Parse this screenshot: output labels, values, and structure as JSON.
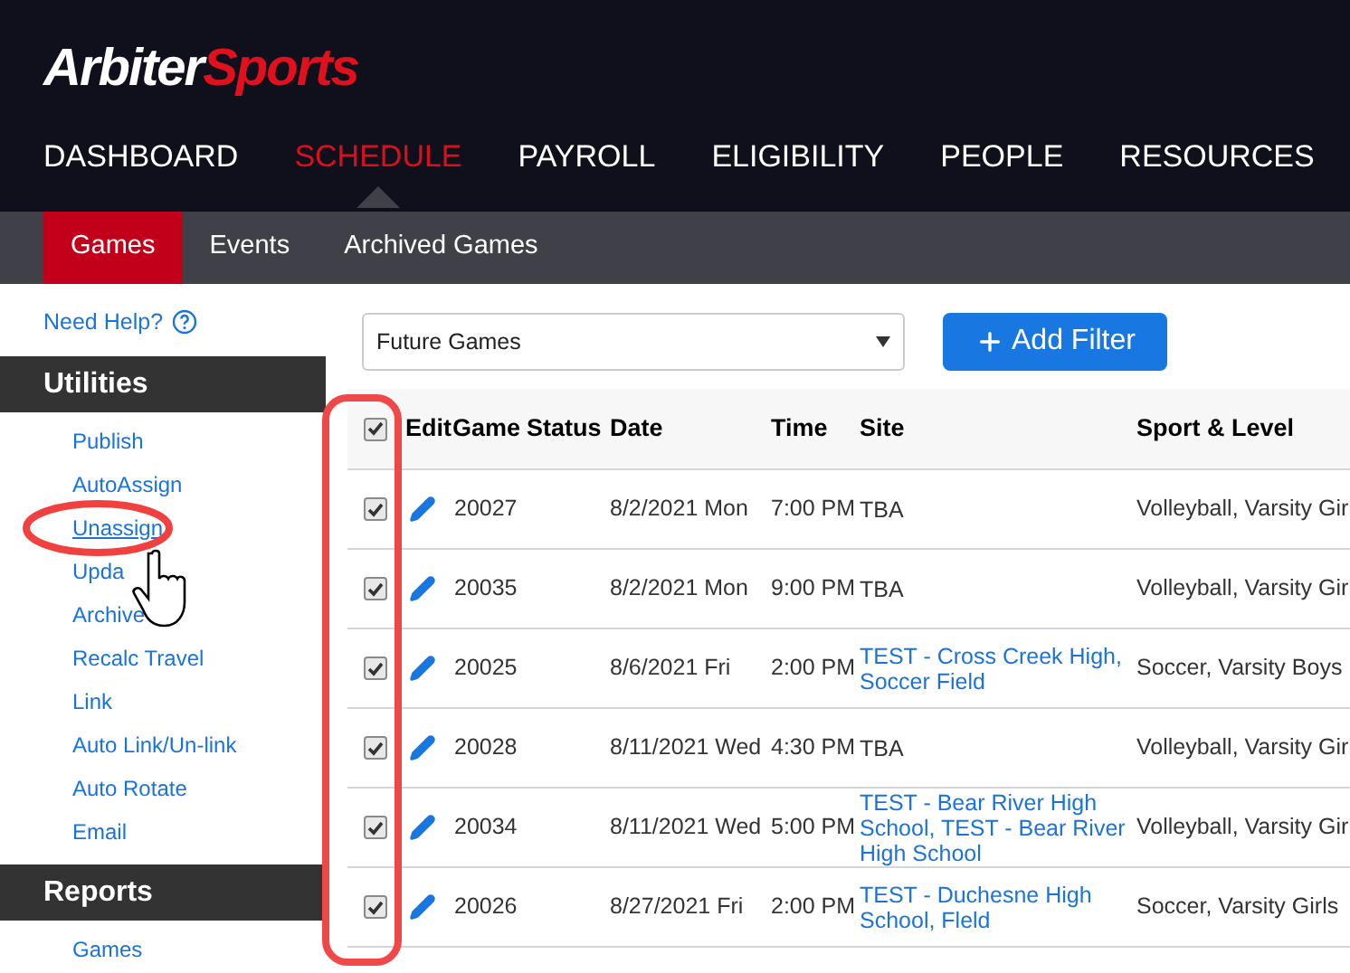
{
  "logo": {
    "parts": [
      {
        "text": "Arbiter",
        "kind": "plain"
      },
      {
        "text": "Sports",
        "kind": "accent"
      }
    ]
  },
  "nav": [
    {
      "label": "DASHBOARD",
      "selected": false
    },
    {
      "label": "SCHEDULE",
      "selected": true
    },
    {
      "label": "PAYROLL",
      "selected": false
    },
    {
      "label": "ELIGIBILITY",
      "selected": false
    },
    {
      "label": "PEOPLE",
      "selected": false
    },
    {
      "label": "RESOURCES",
      "selected": false
    }
  ],
  "subnav": [
    {
      "label": "Games",
      "selected": true
    },
    {
      "label": "Events",
      "selected": false
    },
    {
      "label": "Archived Games",
      "selected": false
    }
  ],
  "sidebar": {
    "help": "Need Help?",
    "sections": [
      {
        "title": "Utilities",
        "items": [
          {
            "label": "Publish",
            "hovered": false
          },
          {
            "label": "AutoAssign",
            "hovered": false
          },
          {
            "label": "Unassign",
            "hovered": true
          },
          {
            "label": "Upda",
            "hovered": false
          },
          {
            "label": "Archive",
            "hovered": false
          },
          {
            "label": "Recalc Travel",
            "hovered": false
          },
          {
            "label": "Link",
            "hovered": false
          },
          {
            "label": "Auto Link/Un-link",
            "hovered": false
          },
          {
            "label": "Auto Rotate",
            "hovered": false
          },
          {
            "label": "Email",
            "hovered": false
          }
        ]
      },
      {
        "title": "Reports",
        "items": [
          {
            "label": "Games",
            "hovered": false
          }
        ]
      }
    ]
  },
  "filter": {
    "value": "Future Games"
  },
  "add_filter_button": {
    "label": "Add Filter"
  },
  "table": {
    "select_all_checked": true,
    "columns": [
      "Edit",
      "Game",
      "Status",
      "Date",
      "Time",
      "Site",
      "Sport & Level"
    ],
    "rows": [
      {
        "checked": true,
        "game": "20027",
        "date": "8/2/2021 Mon",
        "time": "7:00 PM",
        "site": "TBA",
        "site_is_link": false,
        "sport": "Volleyball, Varsity Girl"
      },
      {
        "checked": true,
        "game": "20035",
        "date": "8/2/2021 Mon",
        "time": "9:00 PM",
        "site": "TBA",
        "site_is_link": false,
        "sport": "Volleyball, Varsity Girl"
      },
      {
        "checked": true,
        "game": "20025",
        "date": "8/6/2021 Fri",
        "time": "2:00 PM",
        "site": "TEST - Cross Creek High, Soccer Field",
        "site_is_link": true,
        "sport": "Soccer, Varsity Boys"
      },
      {
        "checked": true,
        "game": "20028",
        "date": "8/11/2021 Wed",
        "time": "4:30 PM",
        "site": "TBA",
        "site_is_link": false,
        "sport": "Volleyball, Varsity Girl"
      },
      {
        "checked": true,
        "game": "20034",
        "date": "8/11/2021 Wed",
        "time": "5:00 PM",
        "site": "TEST - Bear River High School, TEST - Bear River High School",
        "site_is_link": true,
        "sport": "Volleyball, Varsity Girl"
      },
      {
        "checked": true,
        "game": "20026",
        "date": "8/27/2021 Fri",
        "time": "2:00 PM",
        "site": "TEST - Duchesne High School, Fleld",
        "site_is_link": true,
        "sport": "Soccer, Varsity Girls"
      }
    ]
  }
}
